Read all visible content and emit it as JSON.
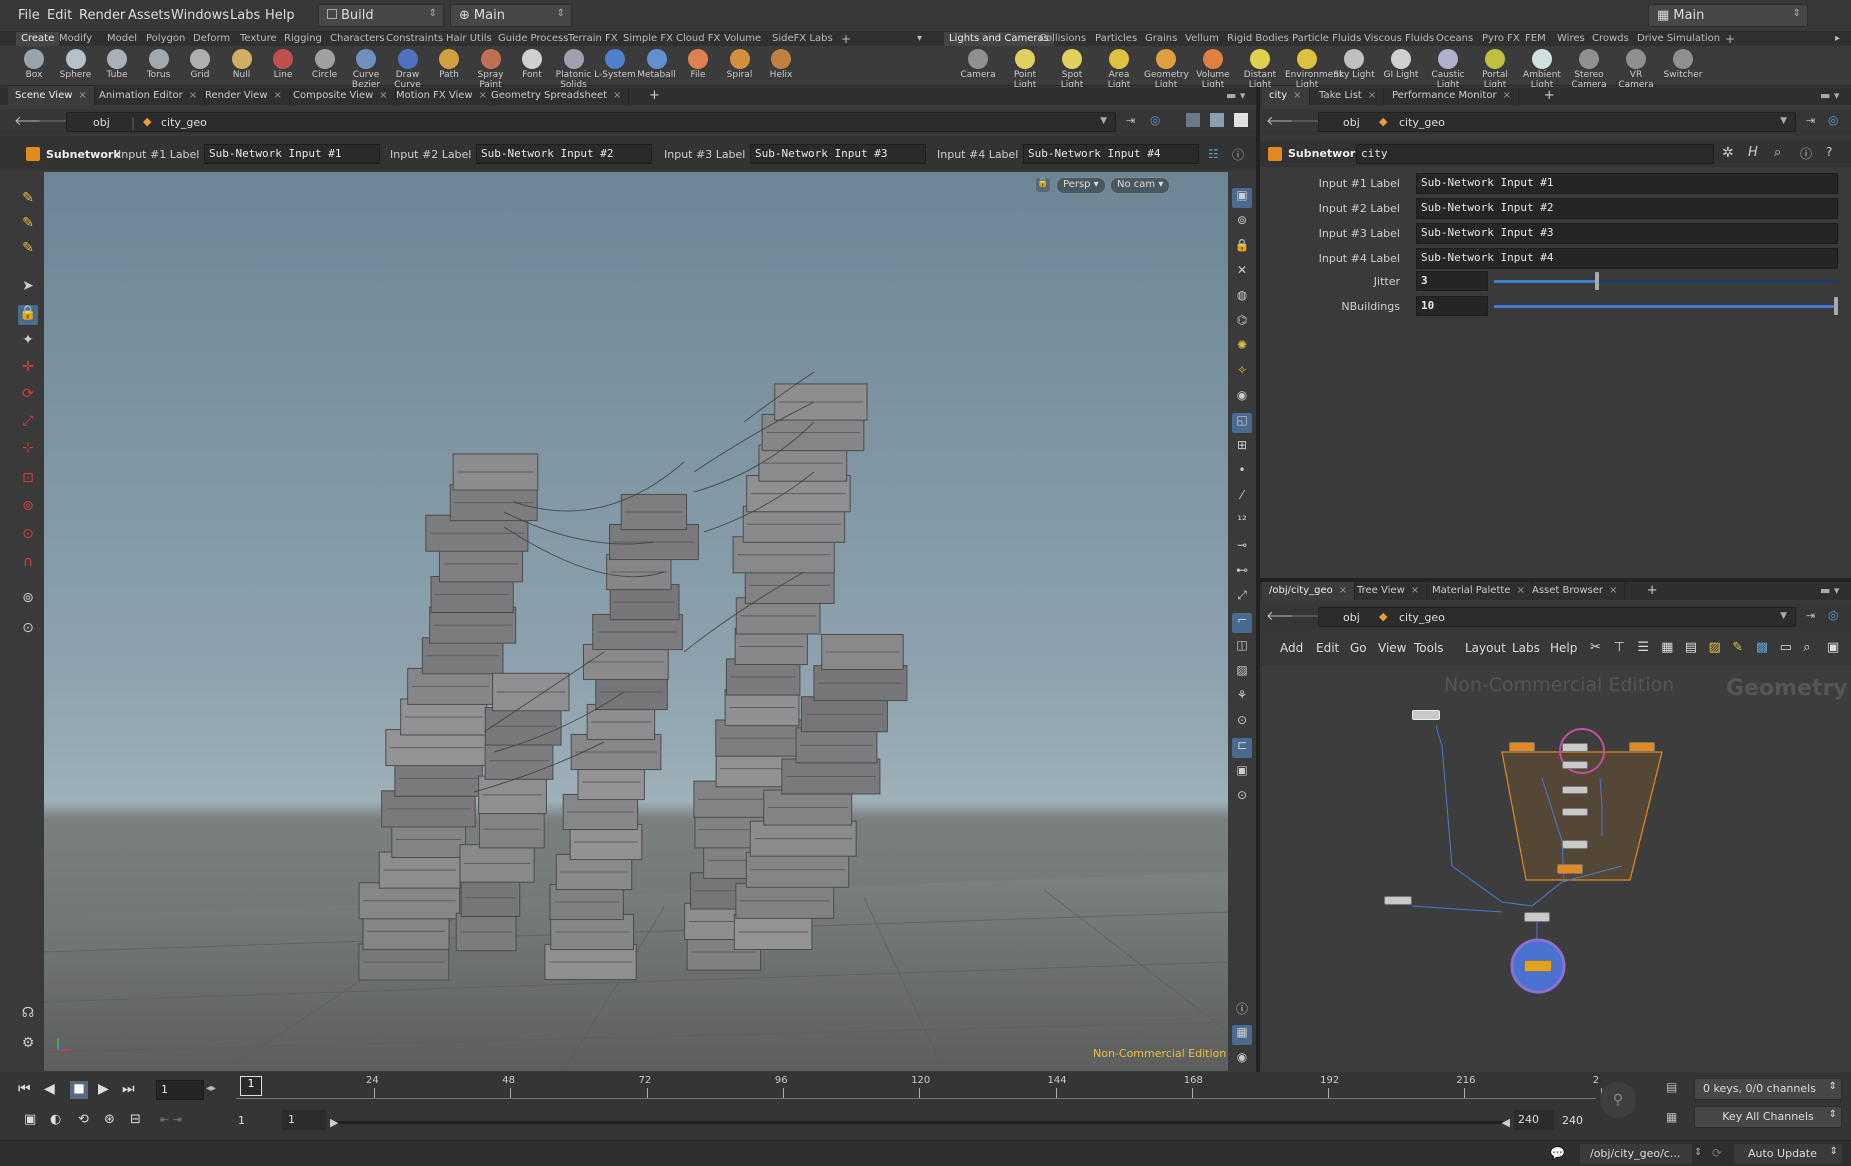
{
  "menubar": {
    "items": [
      "File",
      "Edit",
      "Render",
      "Assets",
      "Windows",
      "Labs",
      "Help"
    ],
    "desktop": "Build",
    "network_context": "Main",
    "right_desktop": "Main"
  },
  "shelf_tabs_left": [
    "Create",
    "Modify",
    "Model",
    "Polygon",
    "Deform",
    "Texture",
    "Rigging",
    "Characters",
    "Constraints",
    "Hair Utils",
    "Guide Process",
    "Terrain FX",
    "Simple FX",
    "Cloud FX",
    "Volume",
    "SideFX Labs"
  ],
  "shelf_tabs_right": [
    "Lights and Cameras",
    "Collisions",
    "Particles",
    "Grains",
    "Vellum",
    "Rigid Bodies",
    "Particle Fluids",
    "Viscous Fluids",
    "Oceans",
    "Pyro FX",
    "FEM",
    "Wires",
    "Crowds",
    "Drive Simulation"
  ],
  "shelf_tools_left": [
    {
      "label": "Box",
      "color": "#9aa4b0"
    },
    {
      "label": "Sphere",
      "color": "#b8c0c8"
    },
    {
      "label": "Tube",
      "color": "#a8b0b8"
    },
    {
      "label": "Torus",
      "color": "#a0a8b0"
    },
    {
      "label": "Grid",
      "color": "#b0b0b0"
    },
    {
      "label": "Null",
      "color": "#d0b060"
    },
    {
      "label": "Line",
      "color": "#c05050"
    },
    {
      "label": "Circle",
      "color": "#a0a0a0"
    },
    {
      "label": "Curve Bezier",
      "color": "#7090c0"
    },
    {
      "label": "Draw Curve",
      "color": "#5070c0"
    },
    {
      "label": "Path",
      "color": "#d0a040"
    },
    {
      "label": "Spray Paint",
      "color": "#c07050"
    },
    {
      "label": "Font",
      "color": "#d0d0d0"
    },
    {
      "label": "Platonic Solids",
      "color": "#a0a0b0"
    },
    {
      "label": "L-System",
      "color": "#5080d0"
    },
    {
      "label": "Metaball",
      "color": "#6090d0"
    },
    {
      "label": "File",
      "color": "#e08050"
    },
    {
      "label": "Spiral",
      "color": "#d09040"
    },
    {
      "label": "Helix",
      "color": "#c08040"
    }
  ],
  "shelf_tools_right": [
    {
      "label": "Camera",
      "color": "#909090"
    },
    {
      "label": "Point Light",
      "color": "#e0d060"
    },
    {
      "label": "Spot Light",
      "color": "#e0d060"
    },
    {
      "label": "Area Light",
      "color": "#e0c040"
    },
    {
      "label": "Geometry Light",
      "color": "#e0a040"
    },
    {
      "label": "Volume Light",
      "color": "#e08040"
    },
    {
      "label": "Distant Light",
      "color": "#e0d050"
    },
    {
      "label": "Environment Light",
      "color": "#e0c040"
    },
    {
      "label": "Sky Light",
      "color": "#c0c0c0"
    },
    {
      "label": "GI Light",
      "color": "#d0d0d0"
    },
    {
      "label": "Caustic Light",
      "color": "#b0b0d0"
    },
    {
      "label": "Portal Light",
      "color": "#c0c040"
    },
    {
      "label": "Ambient Light",
      "color": "#d0e0e0"
    },
    {
      "label": "Stereo Camera",
      "color": "#909090"
    },
    {
      "label": "VR Camera",
      "color": "#909090"
    },
    {
      "label": "Switcher",
      "color": "#909090"
    }
  ],
  "left_pane_tabs": [
    "Scene View",
    "Animation Editor",
    "Render View",
    "Composite View",
    "Motion FX View",
    "Geometry Spreadsheet"
  ],
  "right_top_tabs": [
    "city",
    "Take List",
    "Performance Monitor"
  ],
  "right_bottom_tabs": [
    "/obj/city_geo",
    "Tree View",
    "Material Palette",
    "Asset Browser"
  ],
  "path": {
    "root": "obj",
    "node": "city_geo"
  },
  "operator_bar": {
    "type": "Subnetwork",
    "labels": [
      {
        "label": "Input #1 Label",
        "value": "Sub-Network Input #1"
      },
      {
        "label": "Input #2 Label",
        "value": "Sub-Network Input #2"
      },
      {
        "label": "Input #3 Label",
        "value": "Sub-Network Input #3"
      },
      {
        "label": "Input #4 Label",
        "value": "Sub-Network Input #4"
      }
    ]
  },
  "viewport": {
    "persp": "Persp",
    "cam": "No cam",
    "watermark": "Non-Commercial Edition"
  },
  "parameters": {
    "type": "Subnetwork",
    "name": "city",
    "fields": [
      {
        "label": "Input #1 Label",
        "value": "Sub-Network Input #1"
      },
      {
        "label": "Input #2 Label",
        "value": "Sub-Network Input #2"
      },
      {
        "label": "Input #3 Label",
        "value": "Sub-Network Input #3"
      },
      {
        "label": "Input #4 Label",
        "value": "Sub-Network Input #4"
      }
    ],
    "jitter": {
      "label": "Jitter",
      "value": "3",
      "fraction": 0.3
    },
    "nbuildings": {
      "label": "NBuildings",
      "value": "10",
      "fraction": 1.0
    }
  },
  "network": {
    "menu": [
      "Add",
      "Edit",
      "Go",
      "View",
      "Tools",
      "Layout",
      "Labs",
      "Help"
    ],
    "watermark": "Non-Commercial Edition",
    "context_label": "Geometry"
  },
  "timeline": {
    "ticks": [
      "24",
      "48",
      "72",
      "96",
      "120",
      "144",
      "168",
      "192",
      "216",
      "2"
    ],
    "current_frame": "1",
    "frame_marker": "1",
    "start": "1",
    "start2": "1",
    "end": "240",
    "end2": "240",
    "keys": "0 keys, 0/0 channels",
    "key_all": "Key All Channels"
  },
  "status": {
    "path": "/obj/city_geo/c...",
    "update": "Auto Update"
  }
}
